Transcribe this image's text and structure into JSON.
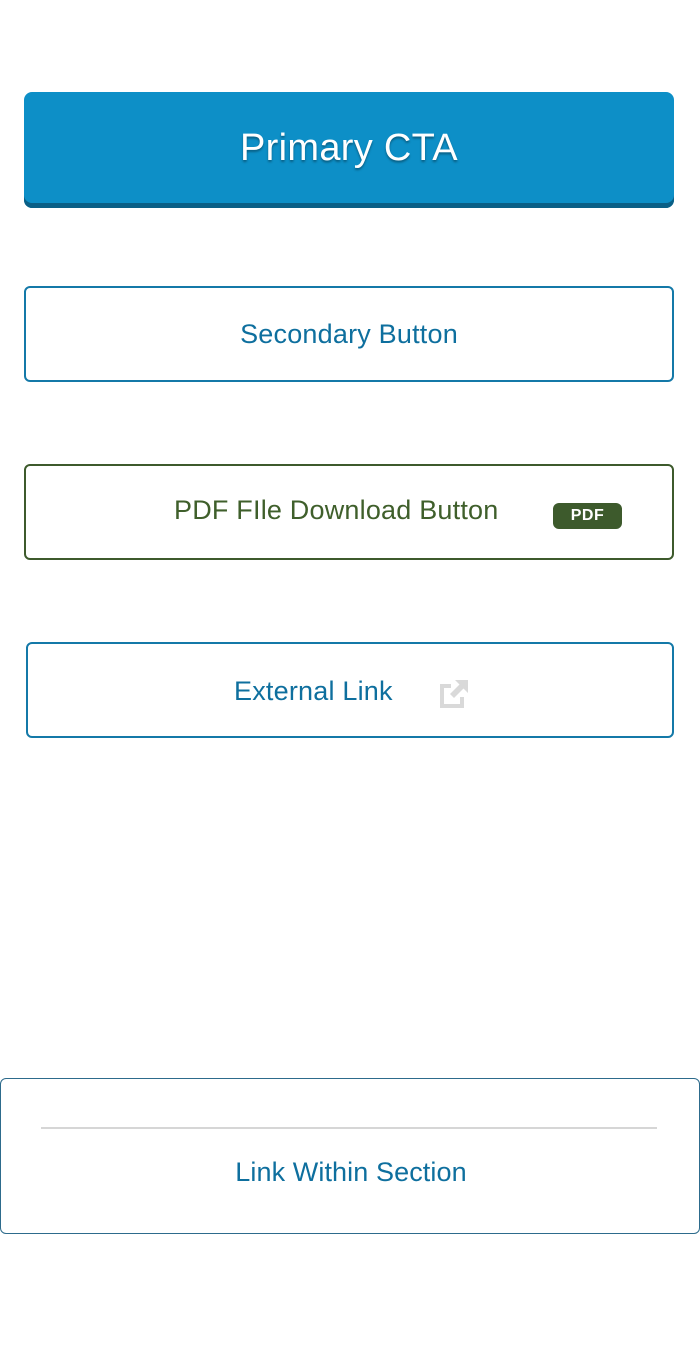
{
  "primary": {
    "label": "Primary CTA"
  },
  "secondary": {
    "label": "Secondary Button"
  },
  "pdf_download": {
    "label": "PDF FIle Download Button",
    "badge": "PDF"
  },
  "external": {
    "label": "External Link",
    "icon": "external-link-icon"
  },
  "section": {
    "link_label": "Link Within Section"
  },
  "colors": {
    "primary_bg": "#0d8fc7",
    "link_blue": "#0e6f9e",
    "pdf_green": "#3d5a2c",
    "icon_gray": "#d9d9d9"
  }
}
